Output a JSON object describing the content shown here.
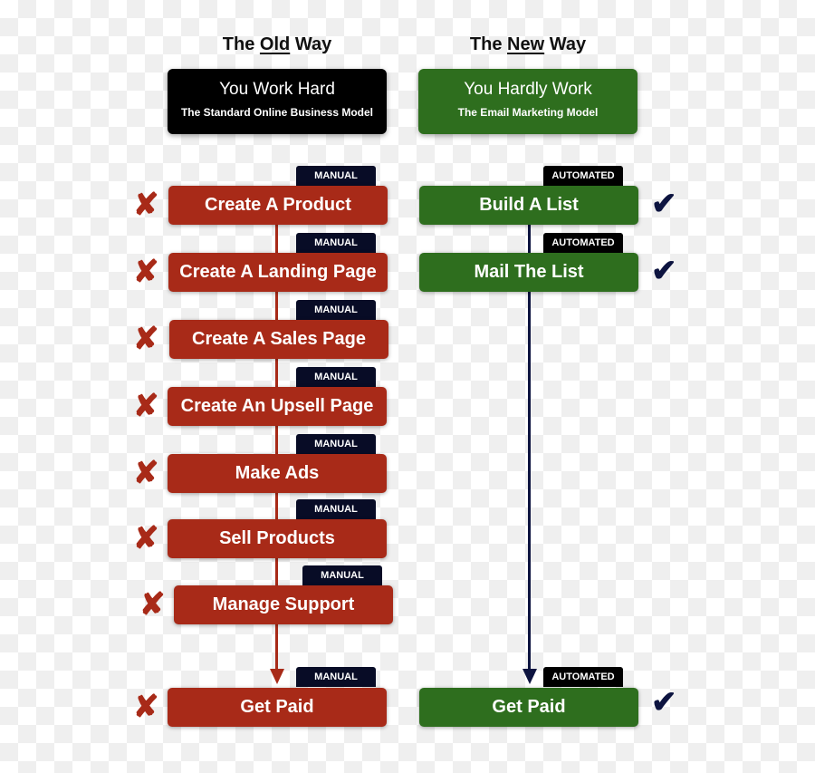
{
  "columns": {
    "old": {
      "heading_prefix": "The ",
      "heading_underlined": "Old",
      "heading_suffix": " Way",
      "title": "You Work Hard",
      "subtitle": "The Standard Online Business Model",
      "color": "#a82a18",
      "header_color": "#000000",
      "steps": [
        {
          "label": "Create A Product",
          "badge": "MANUAL",
          "mark": "cross-icon"
        },
        {
          "label": "Create A Landing Page",
          "badge": "MANUAL",
          "mark": "cross-icon"
        },
        {
          "label": "Create A Sales Page",
          "badge": "MANUAL",
          "mark": "cross-icon"
        },
        {
          "label": "Create An Upsell Page",
          "badge": "MANUAL",
          "mark": "cross-icon"
        },
        {
          "label": "Make Ads",
          "badge": "MANUAL",
          "mark": "cross-icon"
        },
        {
          "label": "Sell Products",
          "badge": "MANUAL",
          "mark": "cross-icon"
        },
        {
          "label": "Manage Support",
          "badge": "MANUAL",
          "mark": "cross-icon"
        },
        {
          "label": "Get Paid",
          "badge": "MANUAL",
          "mark": "cross-icon"
        }
      ]
    },
    "new": {
      "heading_prefix": "The ",
      "heading_underlined": "New",
      "heading_suffix": " Way",
      "title": "You Hardly Work",
      "subtitle": "The Email Marketing Model",
      "color": "#2e6e1e",
      "header_color": "#2e6e1e",
      "steps": [
        {
          "label": "Build A List",
          "badge": "AUTOMATED",
          "mark": "checkmark-icon"
        },
        {
          "label": "Mail The List",
          "badge": "AUTOMATED",
          "mark": "checkmark-icon"
        },
        {
          "label": "Get Paid",
          "badge": "AUTOMATED",
          "mark": "checkmark-icon"
        }
      ]
    }
  },
  "glyphs": {
    "cross": "✘",
    "check": "✔"
  },
  "arrow_color_old": "#a82a18",
  "arrow_color_new": "#0d1440"
}
